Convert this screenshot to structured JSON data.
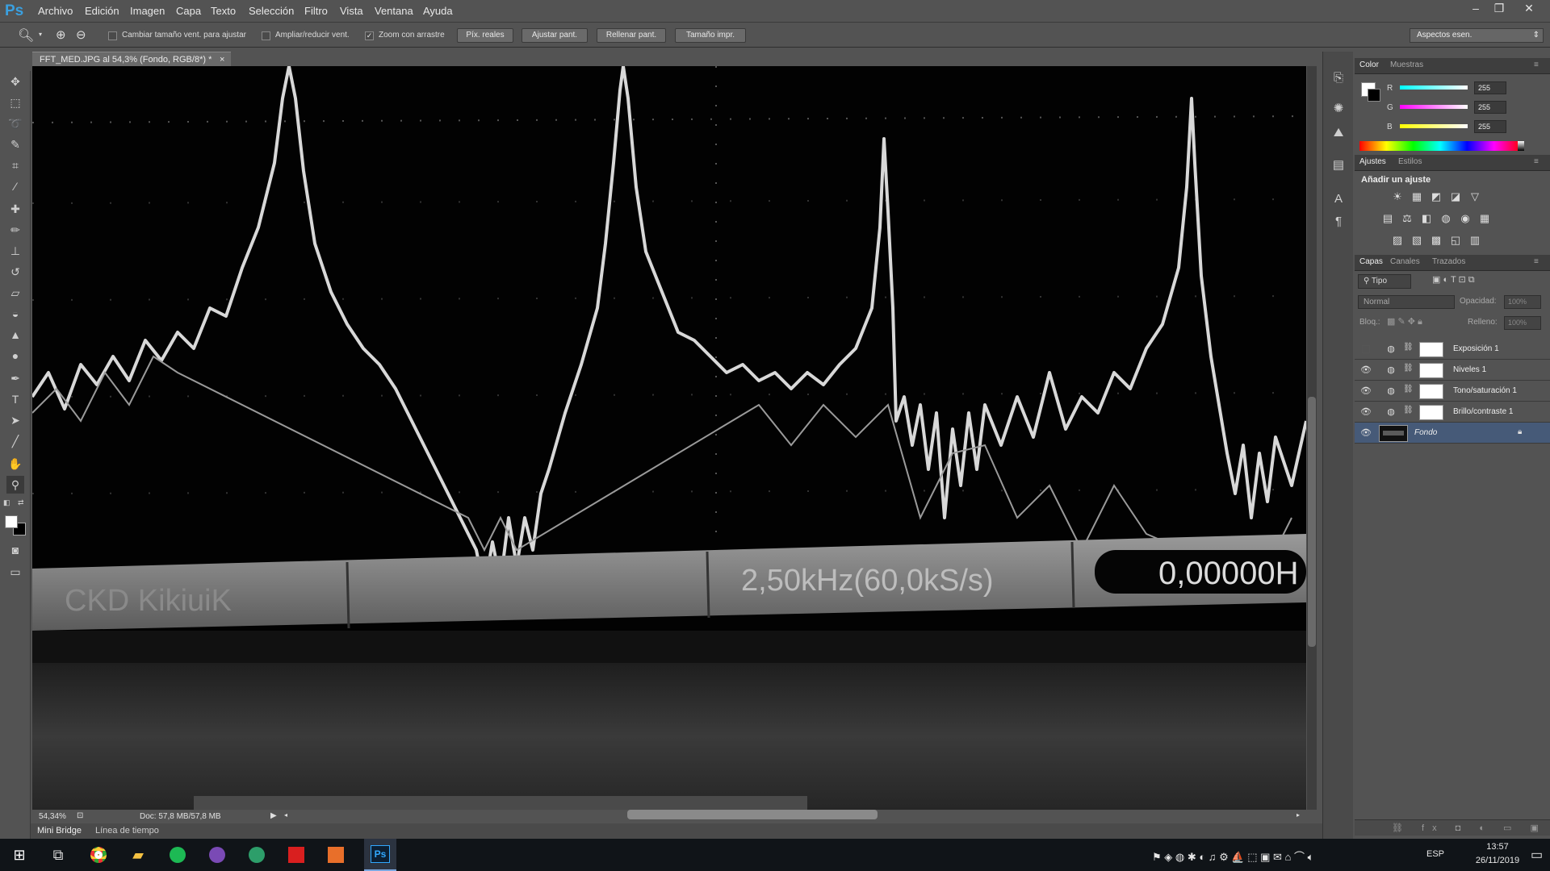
{
  "app": {
    "logo": "Ps"
  },
  "menu": [
    "Archivo",
    "Edición",
    "Imagen",
    "Capa",
    "Texto",
    "Selección",
    "Filtro",
    "Vista",
    "Ventana",
    "Ayuda"
  ],
  "window_controls": {
    "minimize": "–",
    "restore": "❐",
    "close": "✕"
  },
  "options": {
    "resize_windows": "Cambiar tamaño vent. para ajustar",
    "zoom_all": "Ampliar/reducir vent.",
    "scrubby_zoom": "Zoom con arrastre",
    "actual_pixels": "Píx. reales",
    "fit_screen": "Ajustar pant.",
    "fill_screen": "Rellenar pant.",
    "print_size": "Tamaño impr.",
    "workspace": "Aspectos esen."
  },
  "document": {
    "tab_title": "FFT_MED.JPG al 54,3% (Fondo, RGB/8*) *",
    "close": "×",
    "readout_freq": "2,50kHz(60,0kS/s)",
    "readout_value": "0,00000H",
    "readout_left": "CKD  KikiuiK"
  },
  "status": {
    "zoom": "54,34%",
    "doc": "Doc: 57,8 MB/57,8 MB"
  },
  "bottom_tabs": [
    "Mini Bridge",
    "Línea de tiempo"
  ],
  "color_panel": {
    "tabs": [
      "Color",
      "Muestras"
    ],
    "channels": [
      {
        "label": "R",
        "value": "255",
        "color": "#2ee0e0"
      },
      {
        "label": "G",
        "value": "255",
        "color": "#e040e0"
      },
      {
        "label": "B",
        "value": "255",
        "color": "#f0f020"
      }
    ]
  },
  "adjust_panel": {
    "tabs": [
      "Ajustes",
      "Estilos"
    ],
    "title": "Añadir un ajuste",
    "icons": [
      "☀",
      "▦",
      "◩",
      "◪",
      "▽",
      "▤",
      "⚖",
      "◧",
      "◍",
      "◉",
      "▦",
      "▨",
      "▧",
      "▩",
      "◱",
      "▥"
    ]
  },
  "layers_panel": {
    "tabs": [
      "Capas",
      "Canales",
      "Trazados"
    ],
    "filter": "Tipo",
    "blend_mode": "Normal",
    "opacity_label": "Opacidad:",
    "opacity_value": "100%",
    "lock_label": "Bloq.:",
    "fill_label": "Relleno:",
    "fill_value": "100%",
    "layers": [
      {
        "name": "Exposición 1",
        "visible": false
      },
      {
        "name": "Niveles 1",
        "visible": true
      },
      {
        "name": "Tono/saturación 1",
        "visible": true
      },
      {
        "name": "Brillo/contraste 1",
        "visible": true
      },
      {
        "name": "Fondo",
        "visible": true
      }
    ]
  },
  "taskbar": {
    "lang": "ESP",
    "time": "13:57",
    "date": "26/11/2019"
  }
}
